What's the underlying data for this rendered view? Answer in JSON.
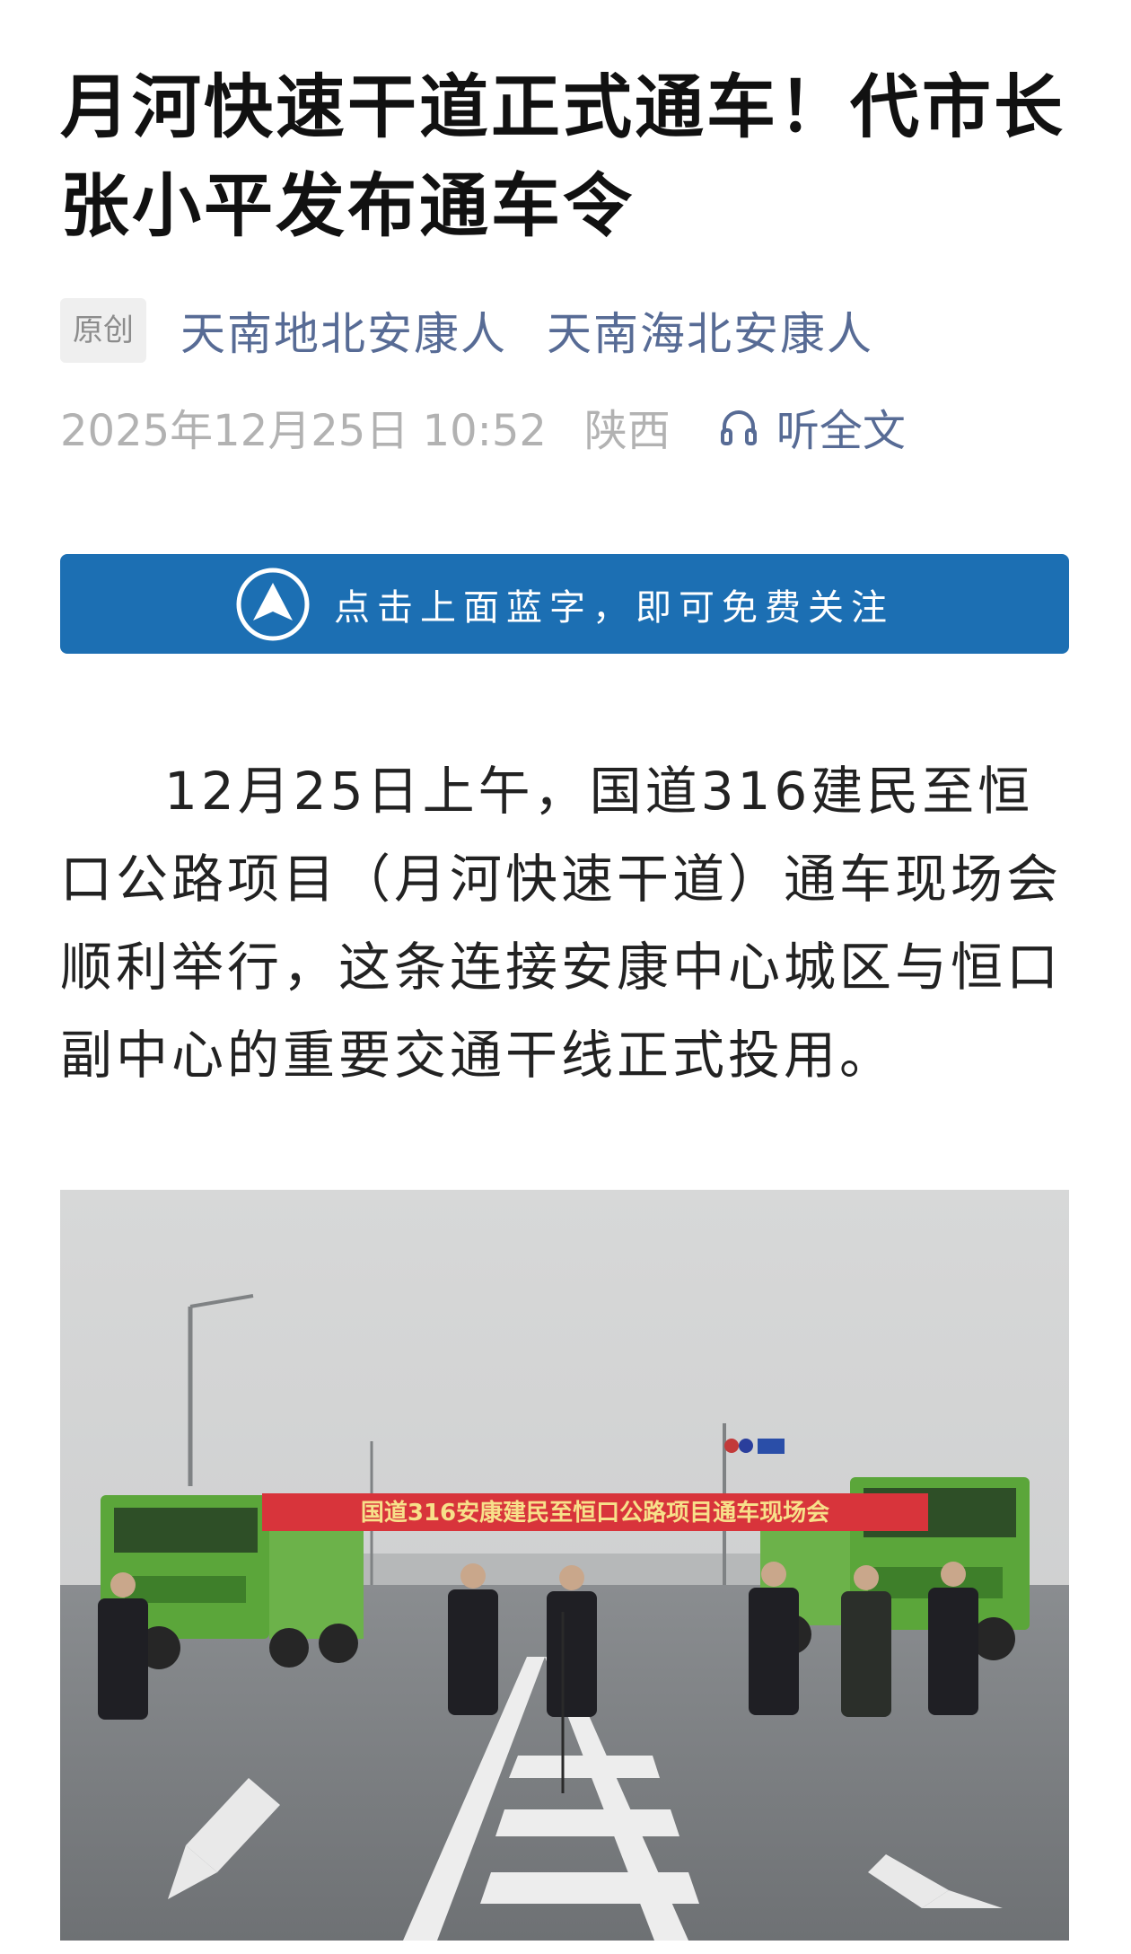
{
  "article": {
    "title": "月河快速干道正式通车！代市长张小平发布通车令",
    "original_tag": "原创",
    "author": "天南地北安康人",
    "account": "天南海北安康人",
    "datetime": "2025年12月25日 10:52",
    "location": "陕西",
    "listen_label": "听全文",
    "follow_banner": "点击上面蓝字，即可免费关注",
    "paragraph": "12月25日上午，国道316建民至恒口公路项目（月河快速干道）通车现场会顺利举行，这条连接安康中心城区与恒口副中心的重要交通干线正式投用。",
    "photo_banner_text": "国道316安康建民至恒口公路项目通车现场会"
  },
  "colors": {
    "link": "#576b95",
    "banner_bg": "#1c6fb3",
    "meta_gray": "#b2b2b2"
  },
  "icons": {
    "listen": "headphones-icon",
    "banner": "up-arrow-circle-icon"
  }
}
